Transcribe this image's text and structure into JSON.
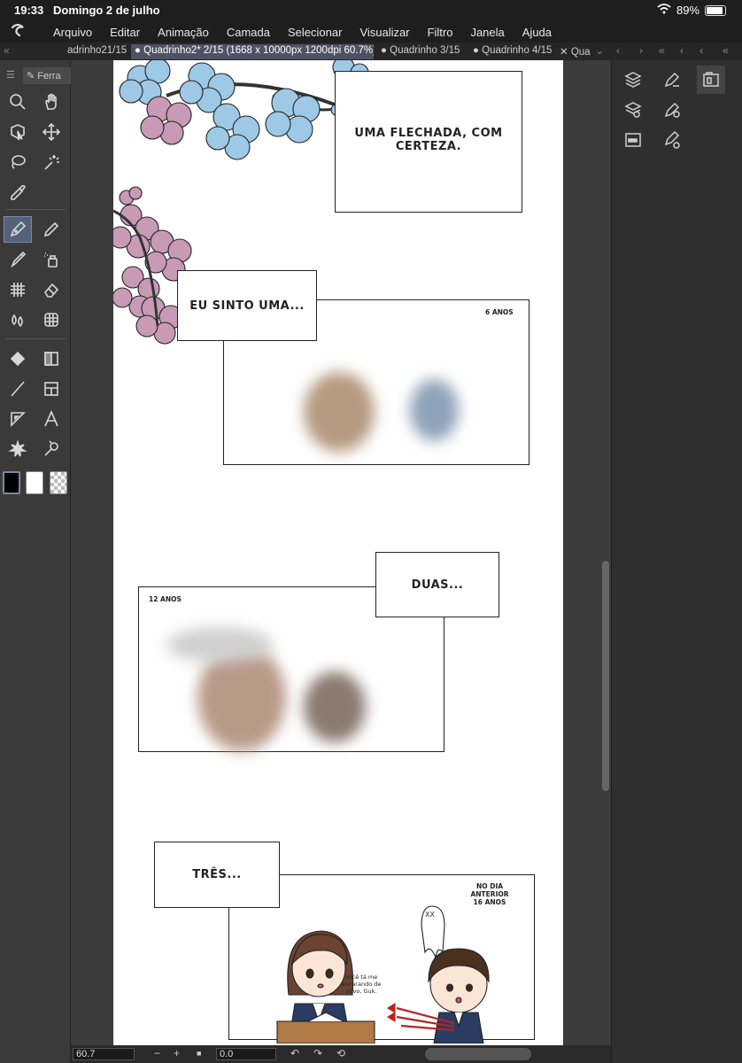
{
  "status": {
    "time": "19:33",
    "date": "Domingo 2 de julho",
    "battery": "89%"
  },
  "menu": {
    "items": [
      "Arquivo",
      "Editar",
      "Animação",
      "Camada",
      "Selecionar",
      "Visualizar",
      "Filtro",
      "Janela",
      "Ajuda"
    ]
  },
  "tabs": [
    {
      "label": "adrinho21/15"
    },
    {
      "label": "● Quadrinho2* 2/15 (1668 x 10000px 1200dpi 60.7%)"
    },
    {
      "label": "● Quadrinho 3/15"
    },
    {
      "label": "● Quadrinho 4/15"
    },
    {
      "label": "✕ Qua"
    }
  ],
  "tool_panel": {
    "tab_label": "Ferra"
  },
  "comic": {
    "bubble1": "UMA FLECHADA, COM CERTEZA.",
    "bubble2": "EU SINTO UMA...",
    "caption1": "6 ANOS",
    "bubble3": "DUAS...",
    "caption2": "12 ANOS",
    "bubble4": "TRÊS...",
    "caption3_line1": "NO DIA ANTERIOR",
    "caption3_line2": "16 ANOS",
    "small_speech": "Você tá me encarando de novo, Guk.",
    "ghost_text": "XX"
  },
  "bottom": {
    "zoom": "60.7",
    "angle": "0.0"
  },
  "colors": {
    "accent": "#55607a",
    "petal_blue": "#9ec9e6",
    "petal_pink": "#c89ab6"
  }
}
